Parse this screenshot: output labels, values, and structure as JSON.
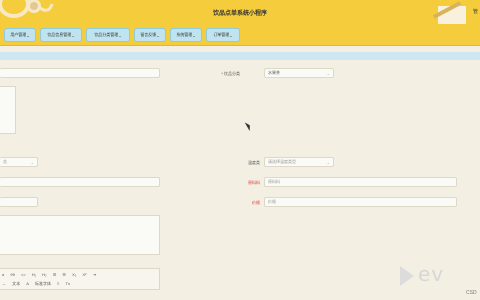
{
  "app": {
    "title": "饮品点单系统小程序",
    "user_text": "管"
  },
  "nav": {
    "items": [
      {
        "label": "用户管理"
      },
      {
        "label": "饮品信息管理"
      },
      {
        "label": "饮品分类管理"
      },
      {
        "label": "留言反馈"
      },
      {
        "label": "系统管理"
      },
      {
        "label": "订单管理"
      }
    ],
    "dropdown_glyph": "⌄"
  },
  "form": {
    "category": {
      "label": "* 饮品分类",
      "value": "水果茶"
    },
    "temperature": {
      "label": "温度类",
      "placeholder": "请选择温度类型"
    },
    "ingredients": {
      "label": "原料料",
      "placeholder": "原料料"
    },
    "price": {
      "label": "价格",
      "placeholder": "价格"
    },
    "select_left": {
      "value": "含"
    }
  },
  "editor": {
    "row1": [
      "ɑ",
      "99",
      "<>",
      "H₁",
      "H₂",
      "☰",
      "☰",
      "X₂",
      "X²",
      "⇥"
    ],
    "row2": [
      "↔",
      "文本",
      "A",
      "标准字体",
      "≡",
      "Tx"
    ]
  },
  "watermark": {
    "brand": "ev",
    "csdn": "CSD"
  },
  "colors": {
    "header_bg": "#f5cd3c",
    "nav_btn_bg": "#bfe3ef",
    "page_bg": "#f3efe3",
    "required_red": "#e03a3a"
  }
}
